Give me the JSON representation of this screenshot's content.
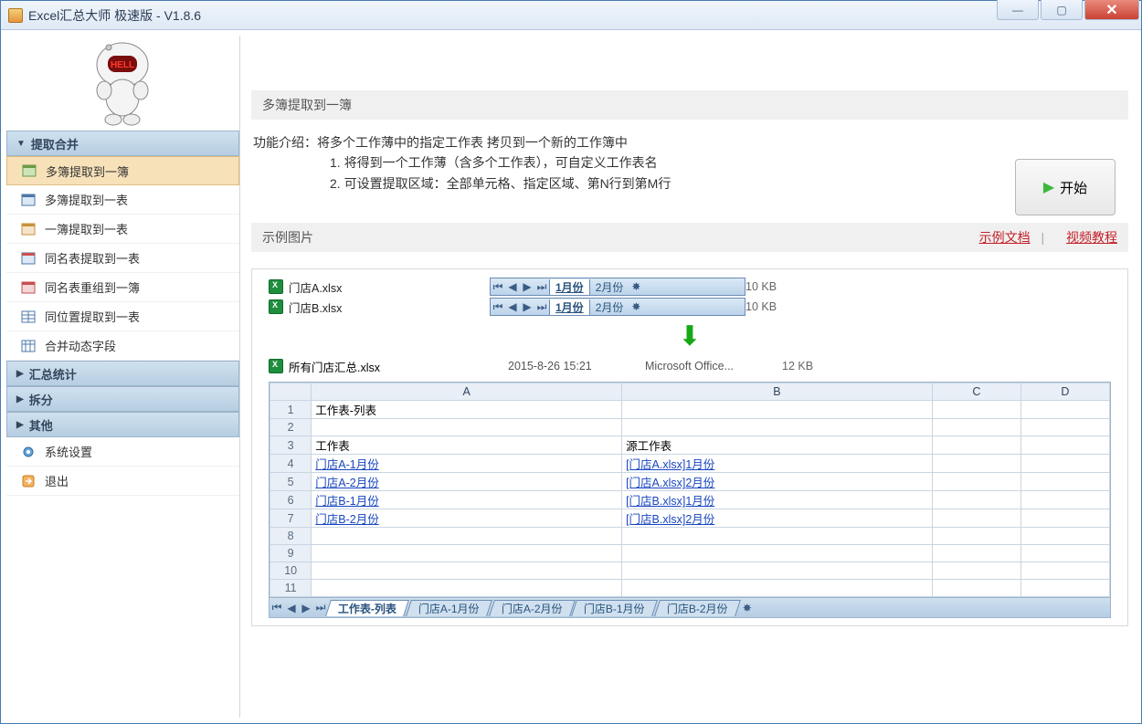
{
  "titlebar": {
    "title": "Excel汇总大师 极速版 - V1.8.6"
  },
  "sidebar": {
    "sections": [
      {
        "label": "提取合并",
        "expanded": true
      },
      {
        "label": "汇总统计",
        "expanded": false
      },
      {
        "label": "拆分",
        "expanded": false
      },
      {
        "label": "其他",
        "expanded": false
      }
    ],
    "items_extract": [
      "多簿提取到一簿",
      "多簿提取到一表",
      "一簿提取到一表",
      "同名表提取到一表",
      "同名表重组到一簿",
      "同位置提取到一表",
      "合并动态字段"
    ],
    "bottom": {
      "settings": "系统设置",
      "exit": "退出"
    }
  },
  "main": {
    "header": "多簿提取到一簿",
    "intro_label": "功能介绍：",
    "intro_text": "将多个工作薄中的指定工作表 拷贝到一个新的工作簿中",
    "bullet1": "1. 将得到一个工作薄（含多个工作表），可自定义工作表名",
    "bullet2": "2. 可设置提取区域：全部单元格、指定区域、第N行到第M行",
    "start": "开始",
    "example_header": "示例图片",
    "link_doc": "示例文档",
    "link_video": "视频教程"
  },
  "example": {
    "file_a": {
      "name": "门店A.xlsx",
      "size": "10 KB",
      "tabs": [
        "1月份",
        "2月份"
      ]
    },
    "file_b": {
      "name": "门店B.xlsx",
      "size": "10 KB",
      "tabs": [
        "1月份",
        "2月份"
      ]
    },
    "output": {
      "name": "所有门店汇总.xlsx",
      "date": "2015-8-26 15:21",
      "type": "Microsoft Office...",
      "size": "12 KB"
    },
    "sheet": {
      "cols": [
        "A",
        "B",
        "C",
        "D"
      ],
      "rows": [
        [
          "工作表-列表",
          "",
          ""
        ],
        [
          "",
          "",
          ""
        ],
        [
          "工作表",
          "源工作表",
          ""
        ],
        [
          "门店A-1月份",
          "[门店A.xlsx]1月份",
          ""
        ],
        [
          "门店A-2月份",
          "[门店A.xlsx]2月份",
          ""
        ],
        [
          "门店B-1月份",
          "[门店B.xlsx]1月份",
          ""
        ],
        [
          "门店B-2月份",
          "[门店B.xlsx]2月份",
          ""
        ],
        [
          "",
          "",
          ""
        ],
        [
          "",
          "",
          ""
        ],
        [
          "",
          "",
          ""
        ],
        [
          "",
          "",
          ""
        ]
      ],
      "link_rows": [
        4,
        5,
        6,
        7
      ],
      "bottom_tabs": [
        "工作表-列表",
        "门店A-1月份",
        "门店A-2月份",
        "门店B-1月份",
        "门店B-2月份"
      ]
    }
  }
}
